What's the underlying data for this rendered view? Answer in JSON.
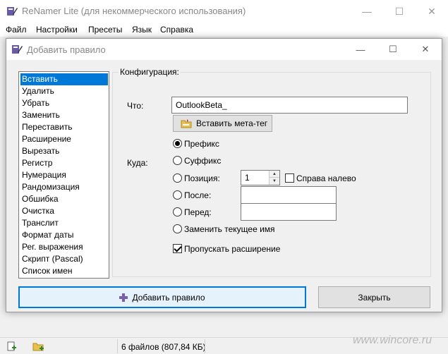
{
  "main_window": {
    "title": "ReNamer Lite (для некоммерческого использования)",
    "controls": {
      "minimize": "—",
      "maximize": "☐",
      "close": "✕"
    }
  },
  "menu": {
    "items": [
      {
        "label": "Файл"
      },
      {
        "label": "Настройки"
      },
      {
        "label": "Пресеты"
      },
      {
        "label": "Язык"
      },
      {
        "label": "Справка"
      }
    ]
  },
  "dialog": {
    "title": "Добавить правило",
    "controls": {
      "minimize": "—",
      "maximize": "☐",
      "close": "✕"
    },
    "rules": [
      {
        "label": "Вставить",
        "selected": true
      },
      {
        "label": "Удалить"
      },
      {
        "label": "Убрать"
      },
      {
        "label": "Заменить"
      },
      {
        "label": "Переставить"
      },
      {
        "label": "Расширение"
      },
      {
        "label": "Вырезать"
      },
      {
        "label": "Регистр"
      },
      {
        "label": "Нумерация"
      },
      {
        "label": "Рандомизация"
      },
      {
        "label": "Обшибка"
      },
      {
        "label": "Очистка"
      },
      {
        "label": "Транслит"
      },
      {
        "label": "Формат даты"
      },
      {
        "label": "Рег. выражения"
      },
      {
        "label": "Скрипт (Pascal)"
      },
      {
        "label": "Список имен"
      }
    ],
    "config": {
      "group_title": "Конфигурация:",
      "what_label": "Что:",
      "what_value": "OutlookBeta_",
      "insert_meta_tag": "Вставить мета-тег",
      "where_label": "Куда:",
      "options": {
        "prefix": "Префикс",
        "suffix": "Суффикс",
        "position": "Позиция:",
        "after": "После:",
        "before": "Перед:",
        "replace_name": "Заменить текущее имя"
      },
      "selected_option": "prefix",
      "position_value": "1",
      "right_to_left": "Справа налево",
      "right_to_left_checked": false,
      "after_value": "",
      "before_value": "",
      "skip_extension": "Пропускать расширение",
      "skip_extension_checked": true
    },
    "buttons": {
      "add": "Добавить правило",
      "close": "Закрыть"
    }
  },
  "status": {
    "files": "6 файлов (807,84 КБ)"
  },
  "watermark": "www.wincore.ru"
}
